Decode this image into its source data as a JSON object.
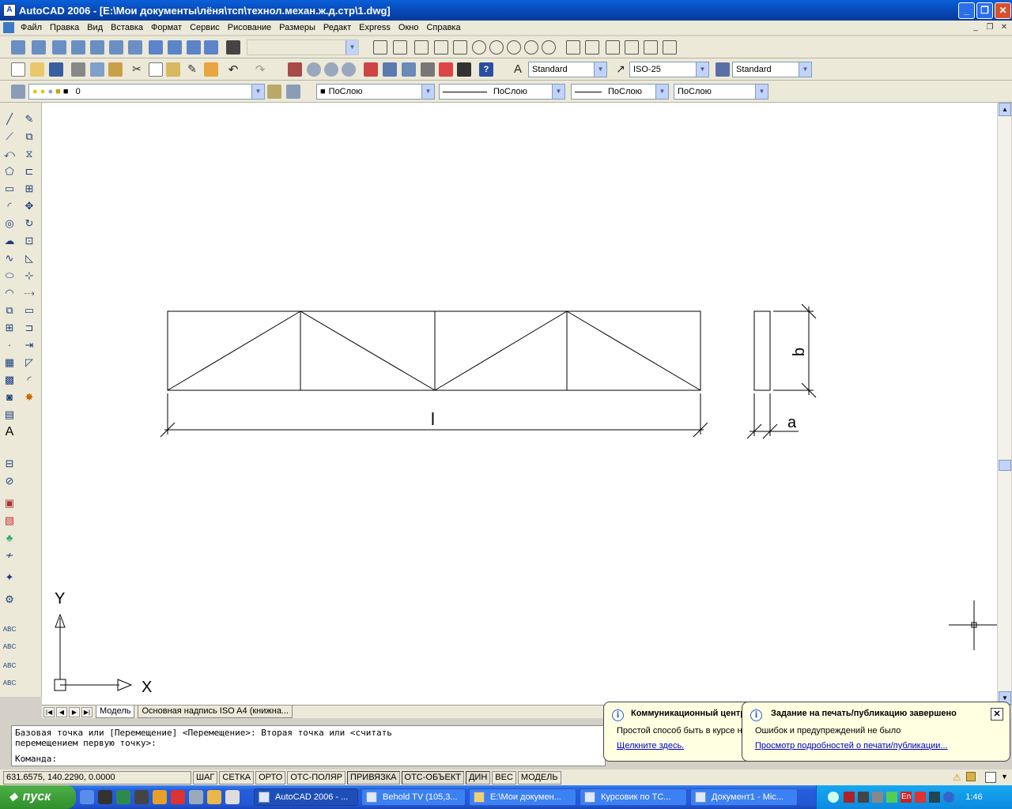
{
  "window": {
    "title": "AutoCAD 2006 - [E:\\Мои документы\\лёня\\тсп\\технол.механ.ж.д.стр\\1.dwg]"
  },
  "menu": [
    "Файл",
    "Правка",
    "Вид",
    "Вставка",
    "Формат",
    "Сервис",
    "Рисование",
    "Размеры",
    "Редакт",
    "Express",
    "Окно",
    "Справка"
  ],
  "toolbar": {
    "text_style": "Standard",
    "dim_style": "ISO-25",
    "table_style": "Standard",
    "layer": "0",
    "color": "ПоСлою",
    "linetype": "ПоСлою",
    "lineweight": "ПоСлою",
    "plot_style": "ПоСлою"
  },
  "drawing": {
    "dim_l": "l",
    "dim_b": "b",
    "dim_a": "a",
    "ucs_x": "X",
    "ucs_y": "Y"
  },
  "tabs": {
    "model": "Модель",
    "layout": "Основная надпись ISO A4 (книжна..."
  },
  "command": {
    "line1": "Базовая точка или [Перемещение] <Перемещение>: Вторая точка или <считать",
    "line2": "перемещением первую точку>:",
    "prompt": "Команда:"
  },
  "status": {
    "coords": "631.6575, 140.2290, 0.0000",
    "buttons": [
      "ШАГ",
      "СЕТКА",
      "ОРТО",
      "ОТС-ПОЛЯР",
      "ПРИВЯЗКА",
      "ОТС-ОБЪЕКТ",
      "ДИН",
      "ВЕС",
      "МОДЕЛЬ"
    ]
  },
  "balloon1": {
    "title": "Коммуникационный центр",
    "text": "Простой способ быть в курсе новостей",
    "link": "Щелкните здесь."
  },
  "balloon2": {
    "title": "Задание на печать/публикацию завершено",
    "text": "Ошибок и предупреждений не было",
    "link": "Просмотр подробностей о печати/публикации..."
  },
  "taskbar": {
    "start": "пуск",
    "tasks": [
      "AutoCAD 2006 - ...",
      "Behold TV (105,3...",
      "E:\\Мои докумен...",
      "Курсовик по ТС...",
      "Документ1 - Mic..."
    ],
    "lang": "EN",
    "tray_lang": "En",
    "clock": "1:46"
  }
}
